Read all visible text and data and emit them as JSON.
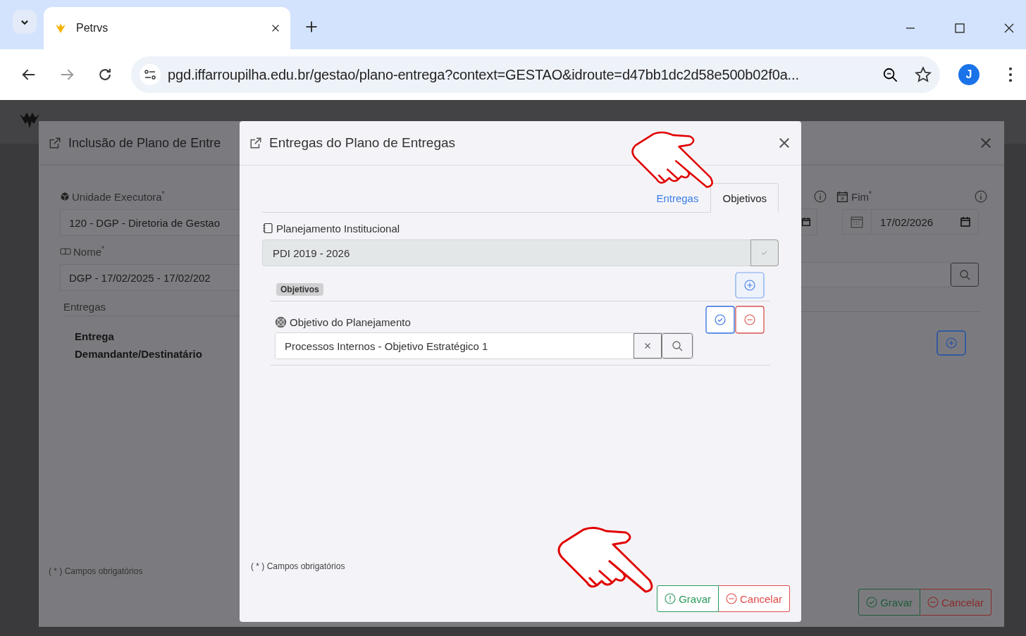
{
  "browser": {
    "tab_title": "Petrvs",
    "url": "pgd.iffarroupilha.edu.br/gestao/plano-entrega?context=GESTAO&idroute=d47bb1dc2d58e500b02f0a...",
    "profile_initial": "J"
  },
  "background_dialog": {
    "title": "Inclusão de Plano de Entre",
    "fields": [
      {
        "label": "Unidade Executora$^{*}$",
        "value": "120 - DGP - Diretoria de Gestao"
      },
      {
        "label": "Nome$^{*}$",
        "value": "DGP - 17/02/2025 - 17/02/202"
      }
    ],
    "section_label": "Entregas",
    "column_header": "Entrega Demandante/Destinatário",
    "end_field": {
      "label": "Fim$^{*}$",
      "value": "17/02/2026"
    },
    "footnote": "( * ) Campos obrigatórios",
    "buttons": [
      {
        "kind": "save",
        "label": "Gravar"
      },
      {
        "kind": "cancel",
        "label": "Cancelar"
      }
    ]
  },
  "dialog": {
    "title": "Entregas do Plano de Entregas",
    "tabs": [
      {
        "label": "Entregas",
        "selected": false
      },
      {
        "label": "Objetivos",
        "selected": true
      }
    ],
    "planning": {
      "label": "Planejamento Institucional",
      "value": "PDI 2019 - 2026"
    },
    "objectives": {
      "badge": "Objetivos",
      "row": {
        "label": "Objetivo do Planejamento",
        "value": "Processos Internos - Objetivo Estratégico 1"
      }
    },
    "footnote": "( * ) Campos obrigatórios",
    "buttons": [
      {
        "kind": "save",
        "label": "Gravar"
      },
      {
        "kind": "cancel",
        "label": "Cancelar"
      }
    ]
  }
}
